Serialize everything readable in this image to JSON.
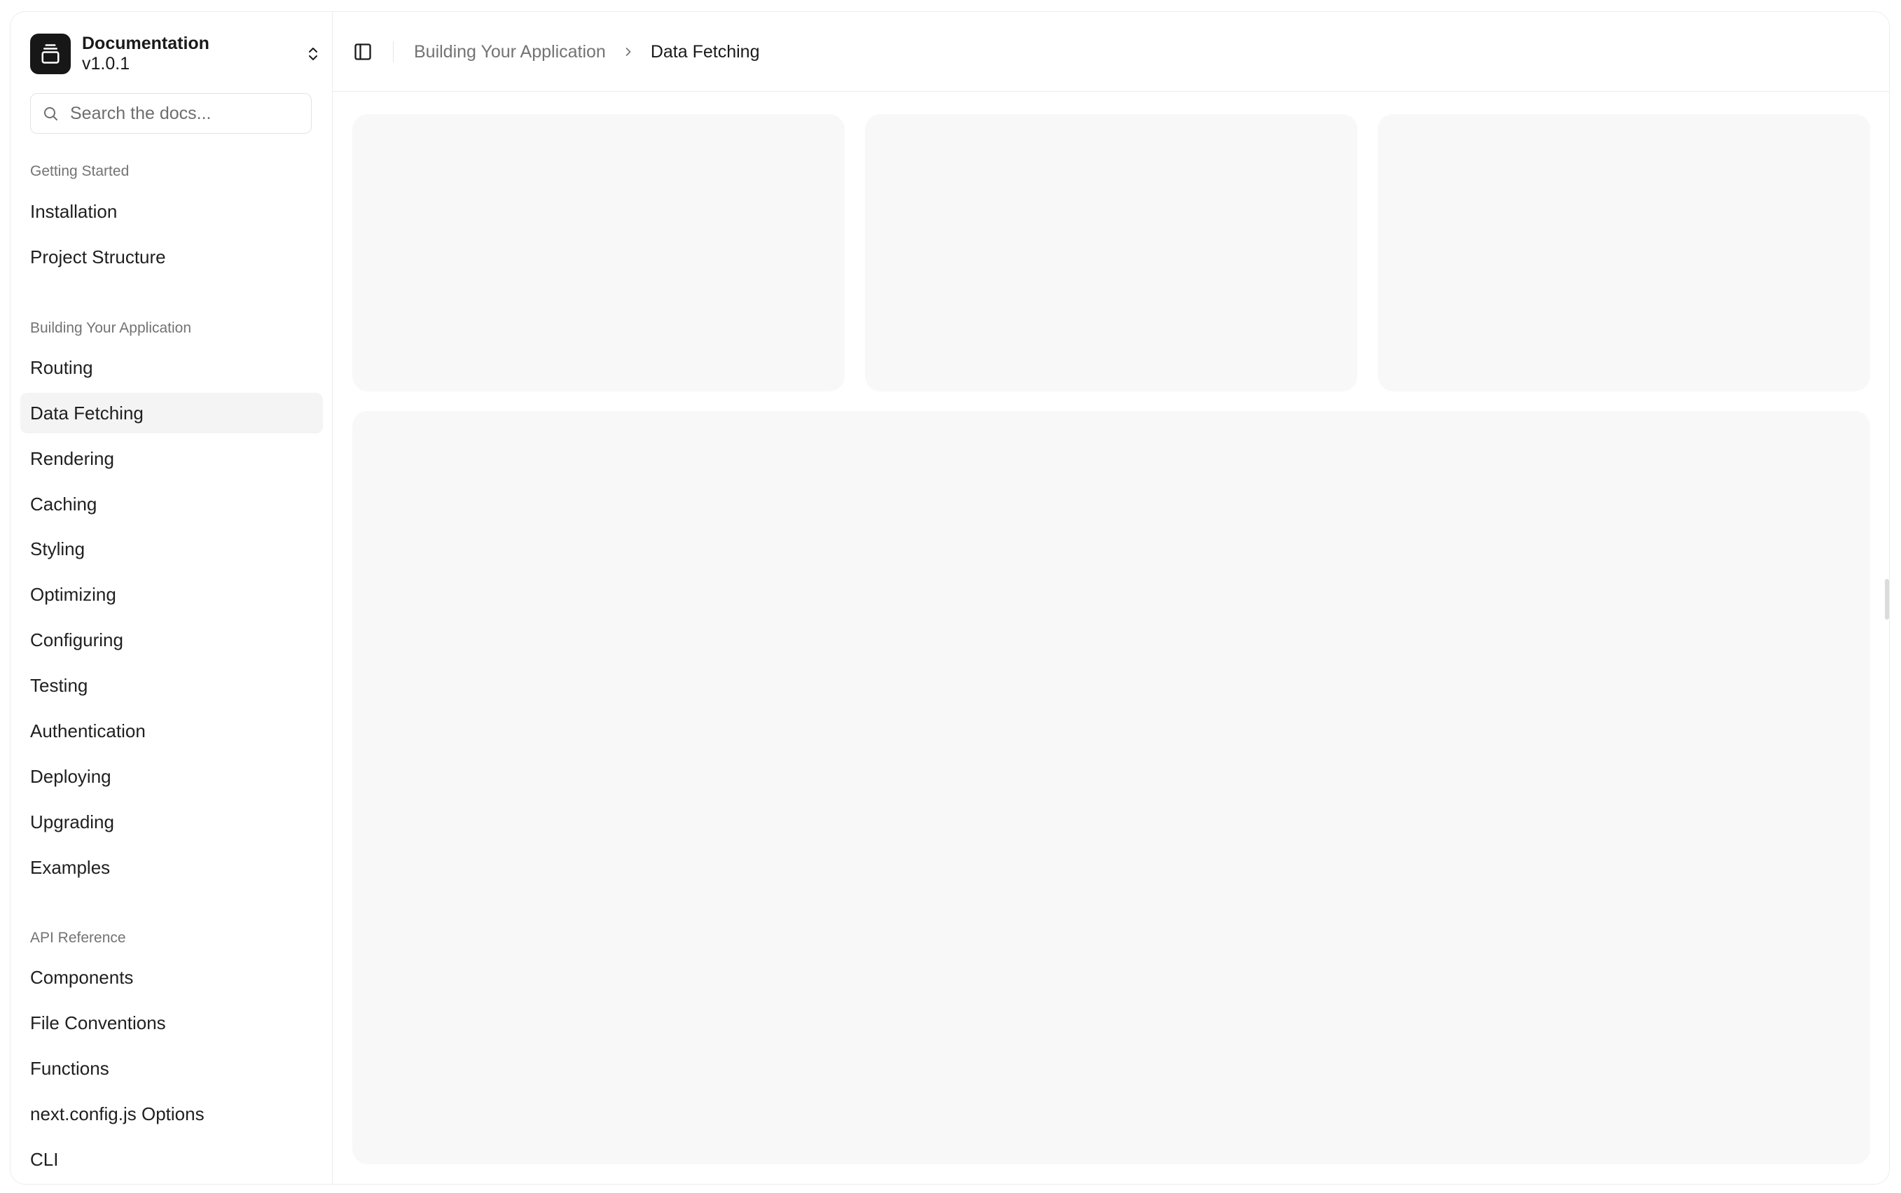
{
  "brand": {
    "title": "Documentation",
    "version": "v1.0.1",
    "logo_icon": "gallery-vertical-end-icon",
    "switch_icon": "chevrons-up-down-icon"
  },
  "search": {
    "placeholder": "Search the docs...",
    "value": "",
    "icon": "search-icon"
  },
  "sidebar": {
    "groups": [
      {
        "label": "Getting Started",
        "items": [
          {
            "label": "Installation",
            "active": false
          },
          {
            "label": "Project Structure",
            "active": false
          }
        ]
      },
      {
        "label": "Building Your Application",
        "items": [
          {
            "label": "Routing",
            "active": false
          },
          {
            "label": "Data Fetching",
            "active": true
          },
          {
            "label": "Rendering",
            "active": false
          },
          {
            "label": "Caching",
            "active": false
          },
          {
            "label": "Styling",
            "active": false
          },
          {
            "label": "Optimizing",
            "active": false
          },
          {
            "label": "Configuring",
            "active": false
          },
          {
            "label": "Testing",
            "active": false
          },
          {
            "label": "Authentication",
            "active": false
          },
          {
            "label": "Deploying",
            "active": false
          },
          {
            "label": "Upgrading",
            "active": false
          },
          {
            "label": "Examples",
            "active": false
          }
        ]
      },
      {
        "label": "API Reference",
        "items": [
          {
            "label": "Components",
            "active": false
          },
          {
            "label": "File Conventions",
            "active": false
          },
          {
            "label": "Functions",
            "active": false
          },
          {
            "label": "next.config.js Options",
            "active": false
          },
          {
            "label": "CLI",
            "active": false
          }
        ]
      }
    ]
  },
  "header": {
    "toggle_icon": "panel-left-icon",
    "breadcrumb": {
      "parent": "Building Your Application",
      "separator_icon": "chevron-right-icon",
      "current": "Data Fetching"
    }
  },
  "colors": {
    "sidebar_active_bg": "#f4f4f5",
    "skeleton_bg": "#f8f8f8",
    "border": "#ececec",
    "muted_text": "#737373"
  }
}
